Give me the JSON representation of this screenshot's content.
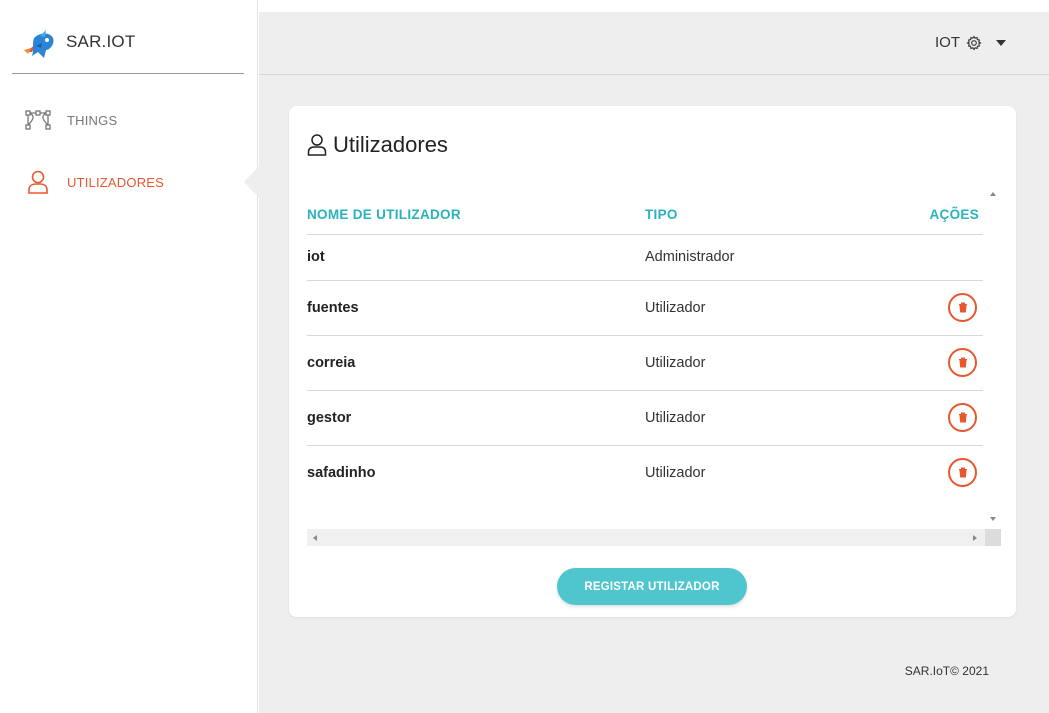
{
  "brand": {
    "name": "SAR.IOT",
    "logo_icon": "dragon-logo-icon"
  },
  "sidebar": {
    "items": [
      {
        "label": "THINGS",
        "icon": "nodes-icon",
        "active": false
      },
      {
        "label": "UTILIZADORES",
        "icon": "user-icon",
        "active": true
      }
    ]
  },
  "topbar": {
    "user_label": "IOT",
    "settings_icon": "gear-icon"
  },
  "card": {
    "title": "Utilizadores",
    "title_icon": "user-icon",
    "columns": {
      "name": "NOME DE UTILIZADOR",
      "type": "TIPO",
      "actions": "AÇÕES"
    },
    "rows": [
      {
        "name": "iot",
        "type": "Administrador",
        "deletable": false
      },
      {
        "name": "fuentes",
        "type": "Utilizador",
        "deletable": true
      },
      {
        "name": "correia",
        "type": "Utilizador",
        "deletable": true
      },
      {
        "name": "gestor",
        "type": "Utilizador",
        "deletable": true
      },
      {
        "name": "safadinho",
        "type": "Utilizador",
        "deletable": true
      }
    ],
    "register_label": "REGISTAR UTILIZADOR"
  },
  "footer": {
    "text": "SAR.IoT© 2021"
  },
  "colors": {
    "accent": "#4fc6cd",
    "header_text": "#27b3bd",
    "danger": "#e8582e",
    "background": "#eeeeee"
  }
}
